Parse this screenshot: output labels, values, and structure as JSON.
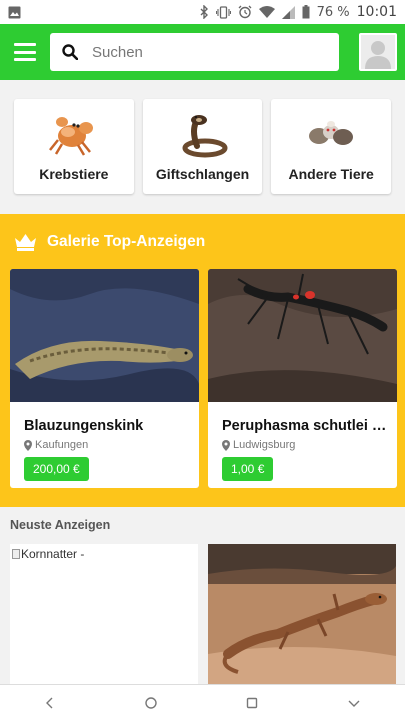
{
  "status_bar": {
    "battery": "76 %",
    "time": "10:01",
    "icons": [
      "image-icon",
      "bluetooth-icon",
      "vibrate-icon",
      "alarm-icon",
      "wifi-icon",
      "signal-icon",
      "battery-icon"
    ]
  },
  "app_bar": {
    "search_placeholder": "Suchen",
    "icons": [
      "menu-icon",
      "search-icon",
      "user-avatar-icon"
    ]
  },
  "categories": [
    {
      "label": "Krebstiere",
      "icon": "crab-icon"
    },
    {
      "label": "Giftschlangen",
      "icon": "snake-icon"
    },
    {
      "label": "Andere Tiere",
      "icon": "animals-icon"
    }
  ],
  "gallery": {
    "title": "Galerie Top-Anzeigen",
    "icon": "crown-icon",
    "items": [
      {
        "name": "Blauzungenskink",
        "location": "Kaufungen",
        "price": "200,00 €"
      },
      {
        "name": "Peruphasma schutlei …",
        "location": "Ludwigsburg",
        "price": "1,00 €"
      }
    ]
  },
  "newest": {
    "title": "Neuste Anzeigen",
    "items": [
      {
        "alt": "Kornnatter -"
      },
      {
        "alt": ""
      }
    ]
  },
  "colors": {
    "brand_green": "#2ecc32",
    "gallery_yellow": "#fdc51a",
    "background": "#f2f2f2"
  }
}
